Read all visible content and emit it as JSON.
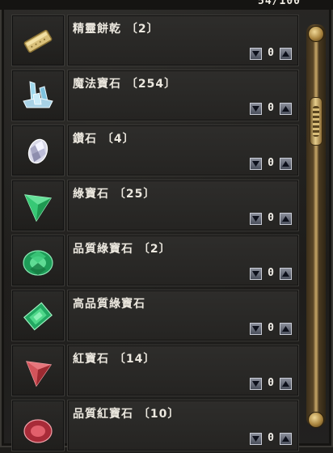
{
  "inventory": {
    "count_label": "54/100",
    "items": [
      {
        "name": "精靈餅乾 〔2〕",
        "icon": "cookie-icon",
        "quantity": "0"
      },
      {
        "name": "魔法寶石 〔254〕",
        "icon": "magic-crystal-icon",
        "quantity": "0"
      },
      {
        "name": "鑽石 〔4〕",
        "icon": "diamond-icon",
        "quantity": "0"
      },
      {
        "name": "綠寶石 〔25〕",
        "icon": "emerald-trillion-icon",
        "quantity": "0"
      },
      {
        "name": "品質綠寶石 〔2〕",
        "icon": "emerald-round-icon",
        "quantity": "0"
      },
      {
        "name": "高品質綠寶石",
        "icon": "emerald-rectangle-icon",
        "quantity": "0"
      },
      {
        "name": "紅寶石 〔14〕",
        "icon": "ruby-trillion-icon",
        "quantity": "0"
      },
      {
        "name": "品質紅寶石 〔10〕",
        "icon": "ruby-round-icon",
        "quantity": "0"
      }
    ]
  },
  "colors": {
    "emerald": "#2fbf6a",
    "ruby": "#c8434a",
    "panel": "#2a2927"
  }
}
